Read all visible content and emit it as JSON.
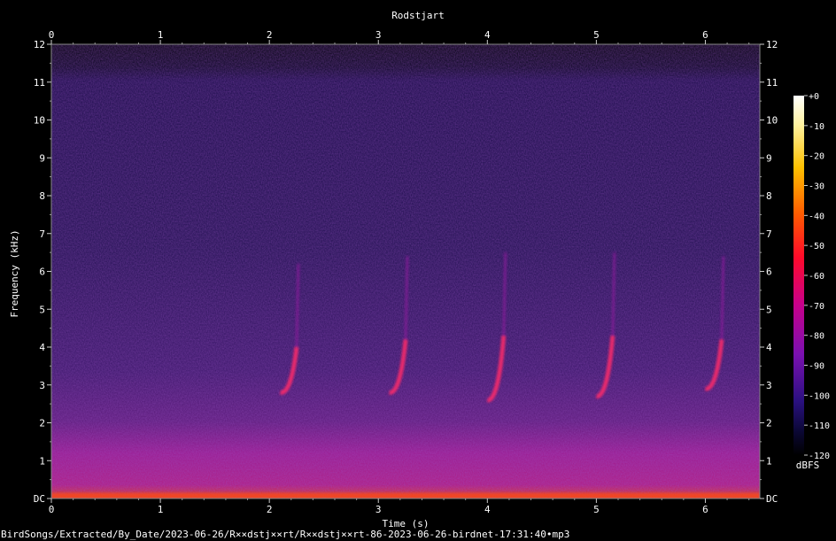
{
  "chart_data": {
    "type": "heatmap",
    "title": "Rodstjart",
    "xlabel": "Time (s)",
    "ylabel": "Frequency (kHz)",
    "xlim": [
      0,
      6.5
    ],
    "ylim": [
      0,
      12
    ],
    "x_ticks": [
      "0",
      "1",
      "2",
      "3",
      "4",
      "5",
      "6"
    ],
    "y_ticks": [
      "DC",
      "1",
      "2",
      "3",
      "4",
      "5",
      "6",
      "7",
      "8",
      "9",
      "10",
      "11",
      "12"
    ],
    "colorbar": {
      "label": "dBFS",
      "ticks": [
        "+0",
        "-10",
        "-20",
        "-30",
        "-40",
        "-50",
        "-60",
        "-70",
        "-80",
        "-90",
        "-100",
        "-110",
        "-120"
      ],
      "range": [
        -120,
        0
      ]
    },
    "calls": [
      {
        "t": 2.2,
        "f_low": 2.8,
        "f_high": 4.0
      },
      {
        "t": 3.2,
        "f_low": 2.8,
        "f_high": 4.2
      },
      {
        "t": 4.1,
        "f_low": 2.6,
        "f_high": 4.3
      },
      {
        "t": 5.1,
        "f_low": 2.7,
        "f_high": 4.3
      },
      {
        "t": 6.1,
        "f_low": 2.9,
        "f_high": 4.2
      }
    ],
    "colors": {
      "background": "#000000",
      "noise": "#1e0f50",
      "low_band": "#9a1a8f",
      "call": "#ff2a6a"
    }
  },
  "footer": {
    "filename": "BirdSongs/Extracted/By_Date/2023-06-26/R××dstj××rt/R××dstj××rt-86-2023-06-26-birdnet-17:31:40•mp3"
  }
}
